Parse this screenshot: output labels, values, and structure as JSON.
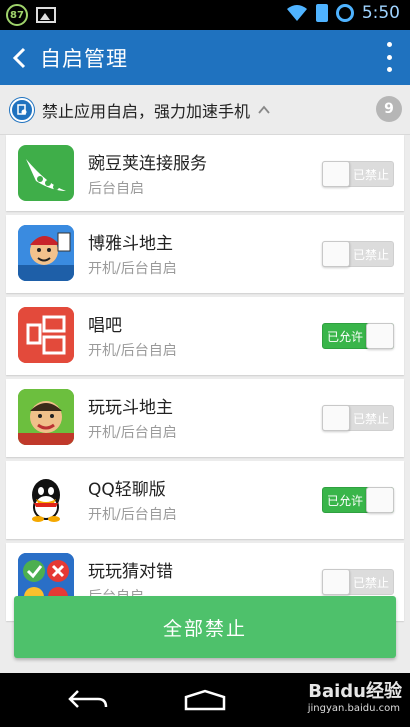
{
  "status_bar": {
    "badge": "87",
    "time": "5:50"
  },
  "header": {
    "title": "自启管理"
  },
  "section": {
    "title": "禁止应用自启，强力加速手机",
    "count": "9"
  },
  "apps": [
    {
      "name": "豌豆荚连接服务",
      "sub": "后台自启",
      "toggle": "已禁止",
      "state": "off",
      "icon": "wandoujia-icon"
    },
    {
      "name": "博雅斗地主",
      "sub": "开机/后台自启",
      "toggle": "已禁止",
      "state": "off",
      "icon": "boya-doudizhu-icon"
    },
    {
      "name": "唱吧",
      "sub": "开机/后台自启",
      "toggle": "已允许",
      "state": "on",
      "icon": "changba-icon"
    },
    {
      "name": "玩玩斗地主",
      "sub": "开机/后台自启",
      "toggle": "已禁止",
      "state": "off",
      "icon": "wanwan-doudizhu-icon"
    },
    {
      "name": "QQ轻聊版",
      "sub": "开机/后台自启",
      "toggle": "已允许",
      "state": "on",
      "icon": "qq-icon"
    },
    {
      "name": "玩玩猜对错",
      "sub": "后台自启",
      "toggle": "已禁止",
      "state": "off",
      "icon": "wanwan-caiduicuo-icon"
    }
  ],
  "footer": {
    "button_label": "全部禁止"
  },
  "watermark": {
    "text": "Baidu经验",
    "sub": "jingyan.baidu.com"
  }
}
